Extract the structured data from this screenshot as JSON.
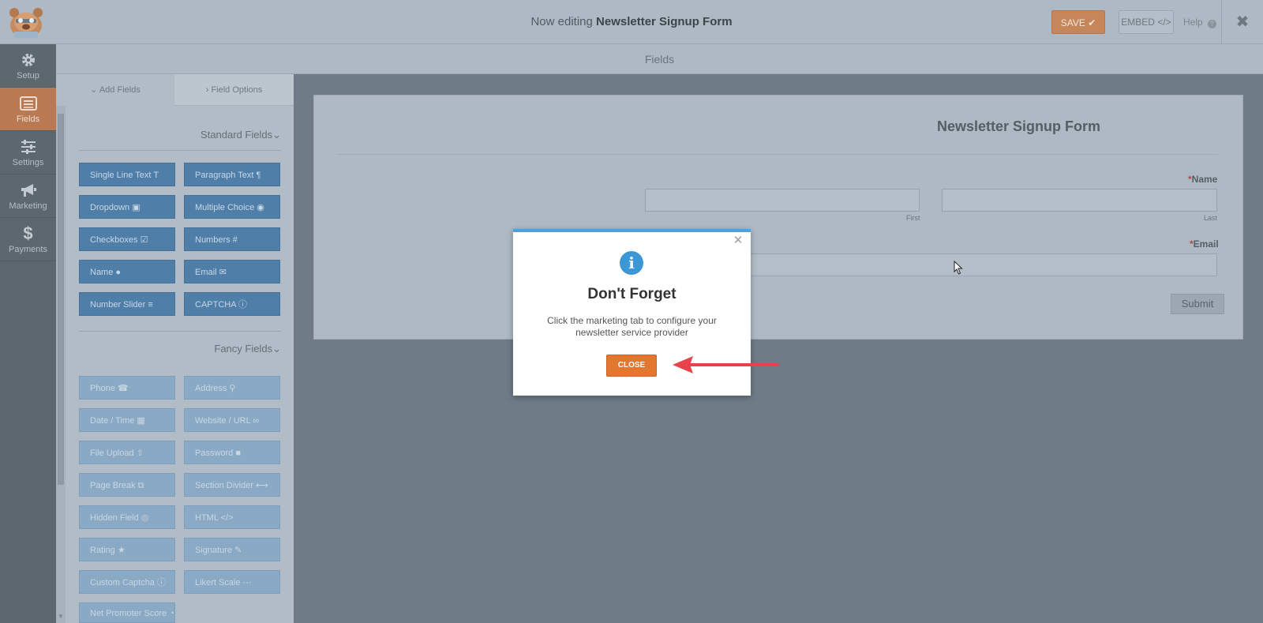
{
  "header": {
    "title_prefix": "Now editing",
    "form_name": "Newsletter Signup Form",
    "save_label": "SAVE",
    "embed_label": "EMBED",
    "help_label": "Help"
  },
  "nav": [
    {
      "label": "Setup",
      "icon": "gear-icon"
    },
    {
      "label": "Fields",
      "icon": "list-icon"
    },
    {
      "label": "Settings",
      "icon": "sliders-icon"
    },
    {
      "label": "Marketing",
      "icon": "megaphone-icon"
    },
    {
      "label": "Payments",
      "icon": "dollar-icon"
    }
  ],
  "fields_header": "Fields",
  "tabs": {
    "add_fields": "Add Fields",
    "field_options": "Field Options"
  },
  "standard": {
    "heading": "Standard Fields",
    "buttons": [
      "Single Line Text",
      "Paragraph Text",
      "Dropdown",
      "Multiple Choice",
      "Checkboxes",
      "Numbers",
      "Name",
      "Email",
      "Number Slider",
      "CAPTCHA"
    ]
  },
  "fancy": {
    "heading": "Fancy Fields",
    "buttons": [
      "Phone",
      "Address",
      "Date / Time",
      "Website / URL",
      "File Upload",
      "Password",
      "Page Break",
      "Section Divider",
      "Hidden Field",
      "HTML",
      "Rating",
      "Signature",
      "Custom Captcha",
      "Likert Scale",
      "Net Promoter Score"
    ]
  },
  "form": {
    "title": "Newsletter Signup Form",
    "name_label": "Name",
    "first_label": "First",
    "last_label": "Last",
    "email_label": "Email",
    "required_mark": "*",
    "submit_label": "Submit"
  },
  "modal": {
    "title": "Don't Forget",
    "message": "Click the marketing tab to configure your newsletter service provider",
    "close_label": "CLOSE"
  }
}
